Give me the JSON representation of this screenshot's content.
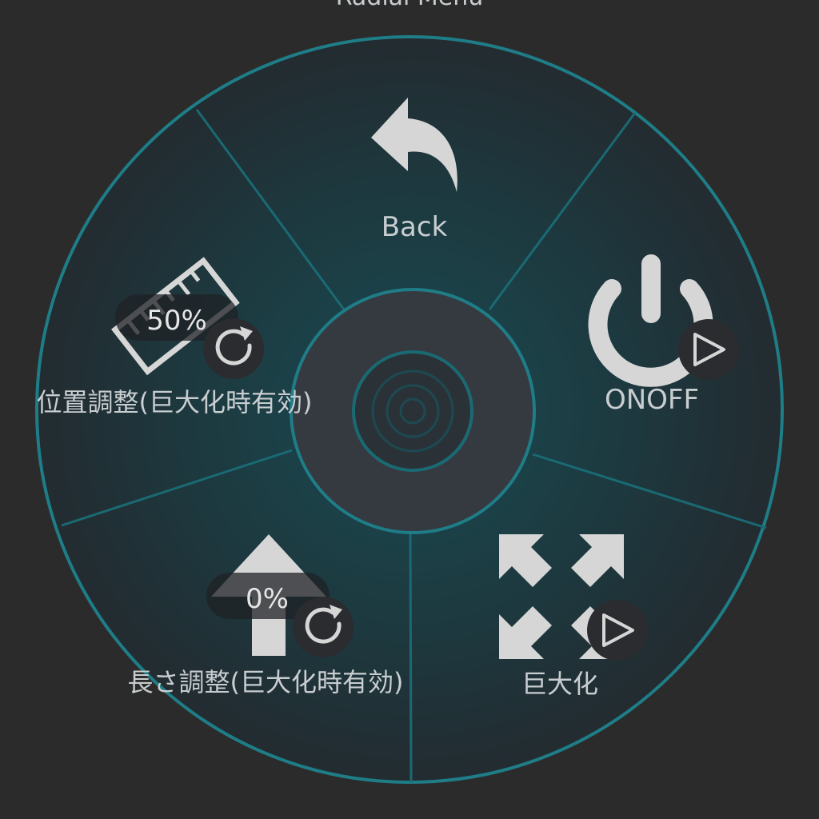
{
  "menu": {
    "title": "Radial Menu",
    "colors": {
      "background": "#2b2b2b",
      "ring": "#1e7d87",
      "sector_fill": "#1d3137",
      "hub": "#353a40",
      "icon": "#d6d6d6",
      "label": "#c8cdd0"
    },
    "items": [
      {
        "id": "back",
        "label": "Back",
        "icon": "back-arrow-icon"
      },
      {
        "id": "onoff",
        "label": "ONOFF",
        "icon": "power-icon",
        "action_icon": "play-icon"
      },
      {
        "id": "enlarge",
        "label": "巨大化",
        "icon": "expand-arrows-icon",
        "action_icon": "play-icon"
      },
      {
        "id": "length",
        "label": "長さ調整(巨大化時有効)",
        "icon": "up-arrow-icon",
        "value": "0%",
        "action_icon": "reset-icon"
      },
      {
        "id": "position",
        "label": "位置調整(巨大化時有効)",
        "icon": "ruler-icon",
        "value": "50%",
        "action_icon": "reset-icon"
      }
    ]
  }
}
